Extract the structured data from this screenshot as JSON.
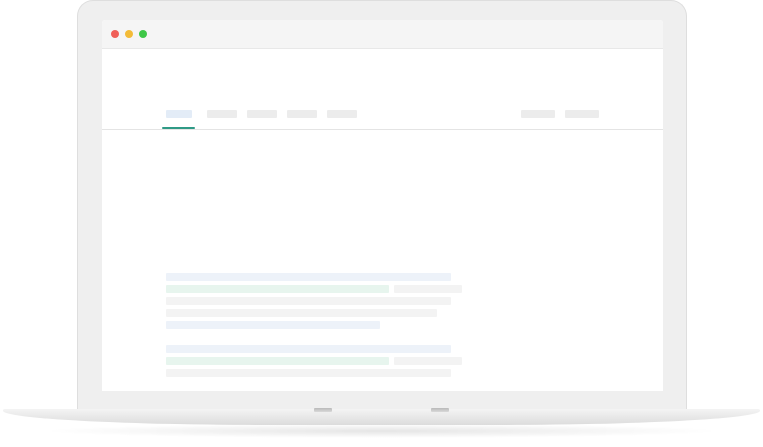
{
  "window": {
    "controls": [
      {
        "name": "close",
        "color": "#f05f58"
      },
      {
        "name": "minimize",
        "color": "#f3bb37"
      },
      {
        "name": "maximize",
        "color": "#3ec747"
      }
    ]
  },
  "nav": {
    "active_tab": 0,
    "accent_color": "#2f9a86"
  },
  "device": {
    "type": "laptop"
  }
}
